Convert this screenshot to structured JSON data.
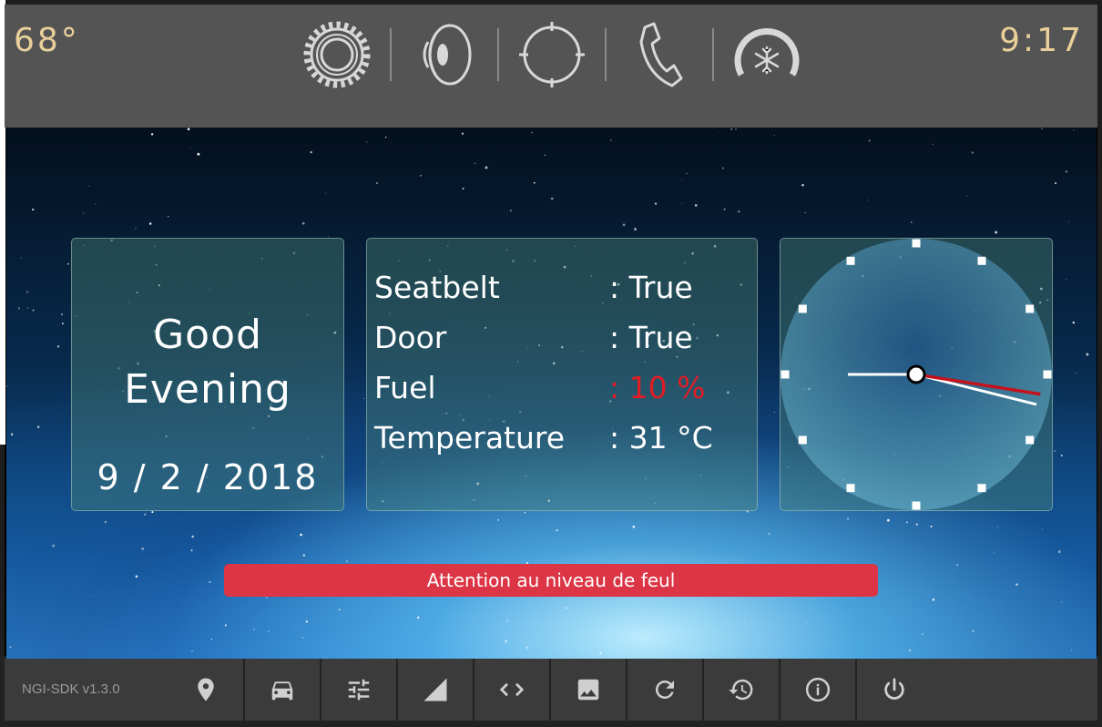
{
  "topbar": {
    "temperature": "68°",
    "time": "9:17",
    "icons": [
      "gear-icon",
      "speaker-icon",
      "crosshair-icon",
      "phone-icon",
      "climate-icon"
    ]
  },
  "greeting": {
    "line1": "Good",
    "line2": "Evening",
    "date": "9 / 2 / 2018"
  },
  "status": {
    "rows": [
      {
        "label": "Seatbelt",
        "value": ": True"
      },
      {
        "label": "Door",
        "value": ": True"
      },
      {
        "label": "Fuel",
        "value": ": 10 %"
      },
      {
        "label": "Temperature",
        "value": ": 31 °C"
      }
    ]
  },
  "clock": {
    "hour_hand_deg": 270,
    "minute_hand_deg": 104,
    "second_hand_deg": 99
  },
  "alert": {
    "message": "Attention au niveau de feul",
    "color": "#dc3545"
  },
  "bottombar": {
    "version": "NGI-SDK v1.3.0",
    "icons": [
      "location-pin-icon",
      "car-icon",
      "tune-sliders-icon",
      "signal-icon",
      "code-icon",
      "image-icon",
      "refresh-icon",
      "history-icon",
      "info-icon",
      "power-icon"
    ]
  },
  "colors": {
    "accent_text": "#e9d09a",
    "warning_red": "#e21c25",
    "bar_background": "#545454"
  }
}
